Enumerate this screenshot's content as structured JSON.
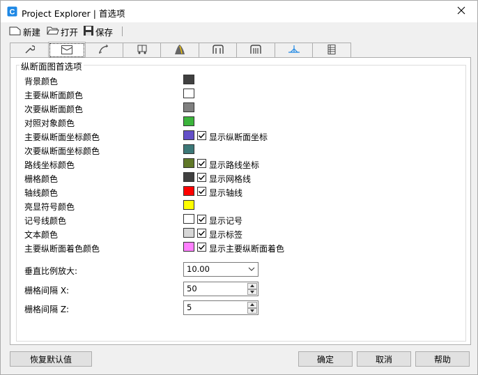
{
  "window": {
    "title": "Project Explorer | 首选项"
  },
  "toolbar": {
    "new_label": "新建",
    "open_label": "打开",
    "save_label": "保存"
  },
  "tabs": [
    {
      "icon": "wrench-icon"
    },
    {
      "icon": "profile-view-icon"
    },
    {
      "icon": "alignment-curve-icon"
    },
    {
      "icon": "vehicle-icon"
    },
    {
      "icon": "road-icon"
    },
    {
      "icon": "cross-section-icon"
    },
    {
      "icon": "assembly-icon"
    },
    {
      "icon": "superelevation-icon"
    },
    {
      "icon": "table-icon"
    }
  ],
  "group": {
    "title": "纵断面图首选项",
    "rows": [
      {
        "label": "背景颜色",
        "color": "#404040"
      },
      {
        "label": "主要纵断面颜色",
        "color": "#ffffff"
      },
      {
        "label": "次要纵断面颜色",
        "color": "#808080"
      },
      {
        "label": "对照对象颜色",
        "color": "#3cb43c"
      },
      {
        "label": "主要纵断面坐标颜色",
        "color": "#6450c8",
        "checkbox": "显示纵断面坐标"
      },
      {
        "label": "次要纵断面坐标颜色",
        "color": "#3c7878"
      },
      {
        "label": "路线坐标颜色",
        "color": "#607828",
        "checkbox": "显示路线坐标"
      },
      {
        "label": "栅格颜色",
        "color": "#404040",
        "checkbox": "显示网格线"
      },
      {
        "label": "轴线颜色",
        "color": "#ff0000",
        "checkbox": "显示轴线"
      },
      {
        "label": "亮显符号颜色",
        "color": "#ffff00"
      },
      {
        "label": "记号线颜色",
        "color": "#ffffff",
        "checkbox": "显示记号"
      },
      {
        "label": "文本颜色",
        "color": "#d7d7d7",
        "checkbox": "显示标签"
      },
      {
        "label": "主要纵断面着色颜色",
        "color": "#ff80ff",
        "checkbox": "显示主要纵断面着色"
      }
    ],
    "vertical_exaggeration": {
      "label": "垂直比例放大:",
      "value": "10.00"
    },
    "grid_x": {
      "label": "栅格间隔 X:",
      "value": "50"
    },
    "grid_z": {
      "label": "栅格间隔 Z:",
      "value": "5"
    }
  },
  "buttons": {
    "reset": "恢复默认值",
    "ok": "确定",
    "cancel": "取消",
    "help": "帮助"
  }
}
